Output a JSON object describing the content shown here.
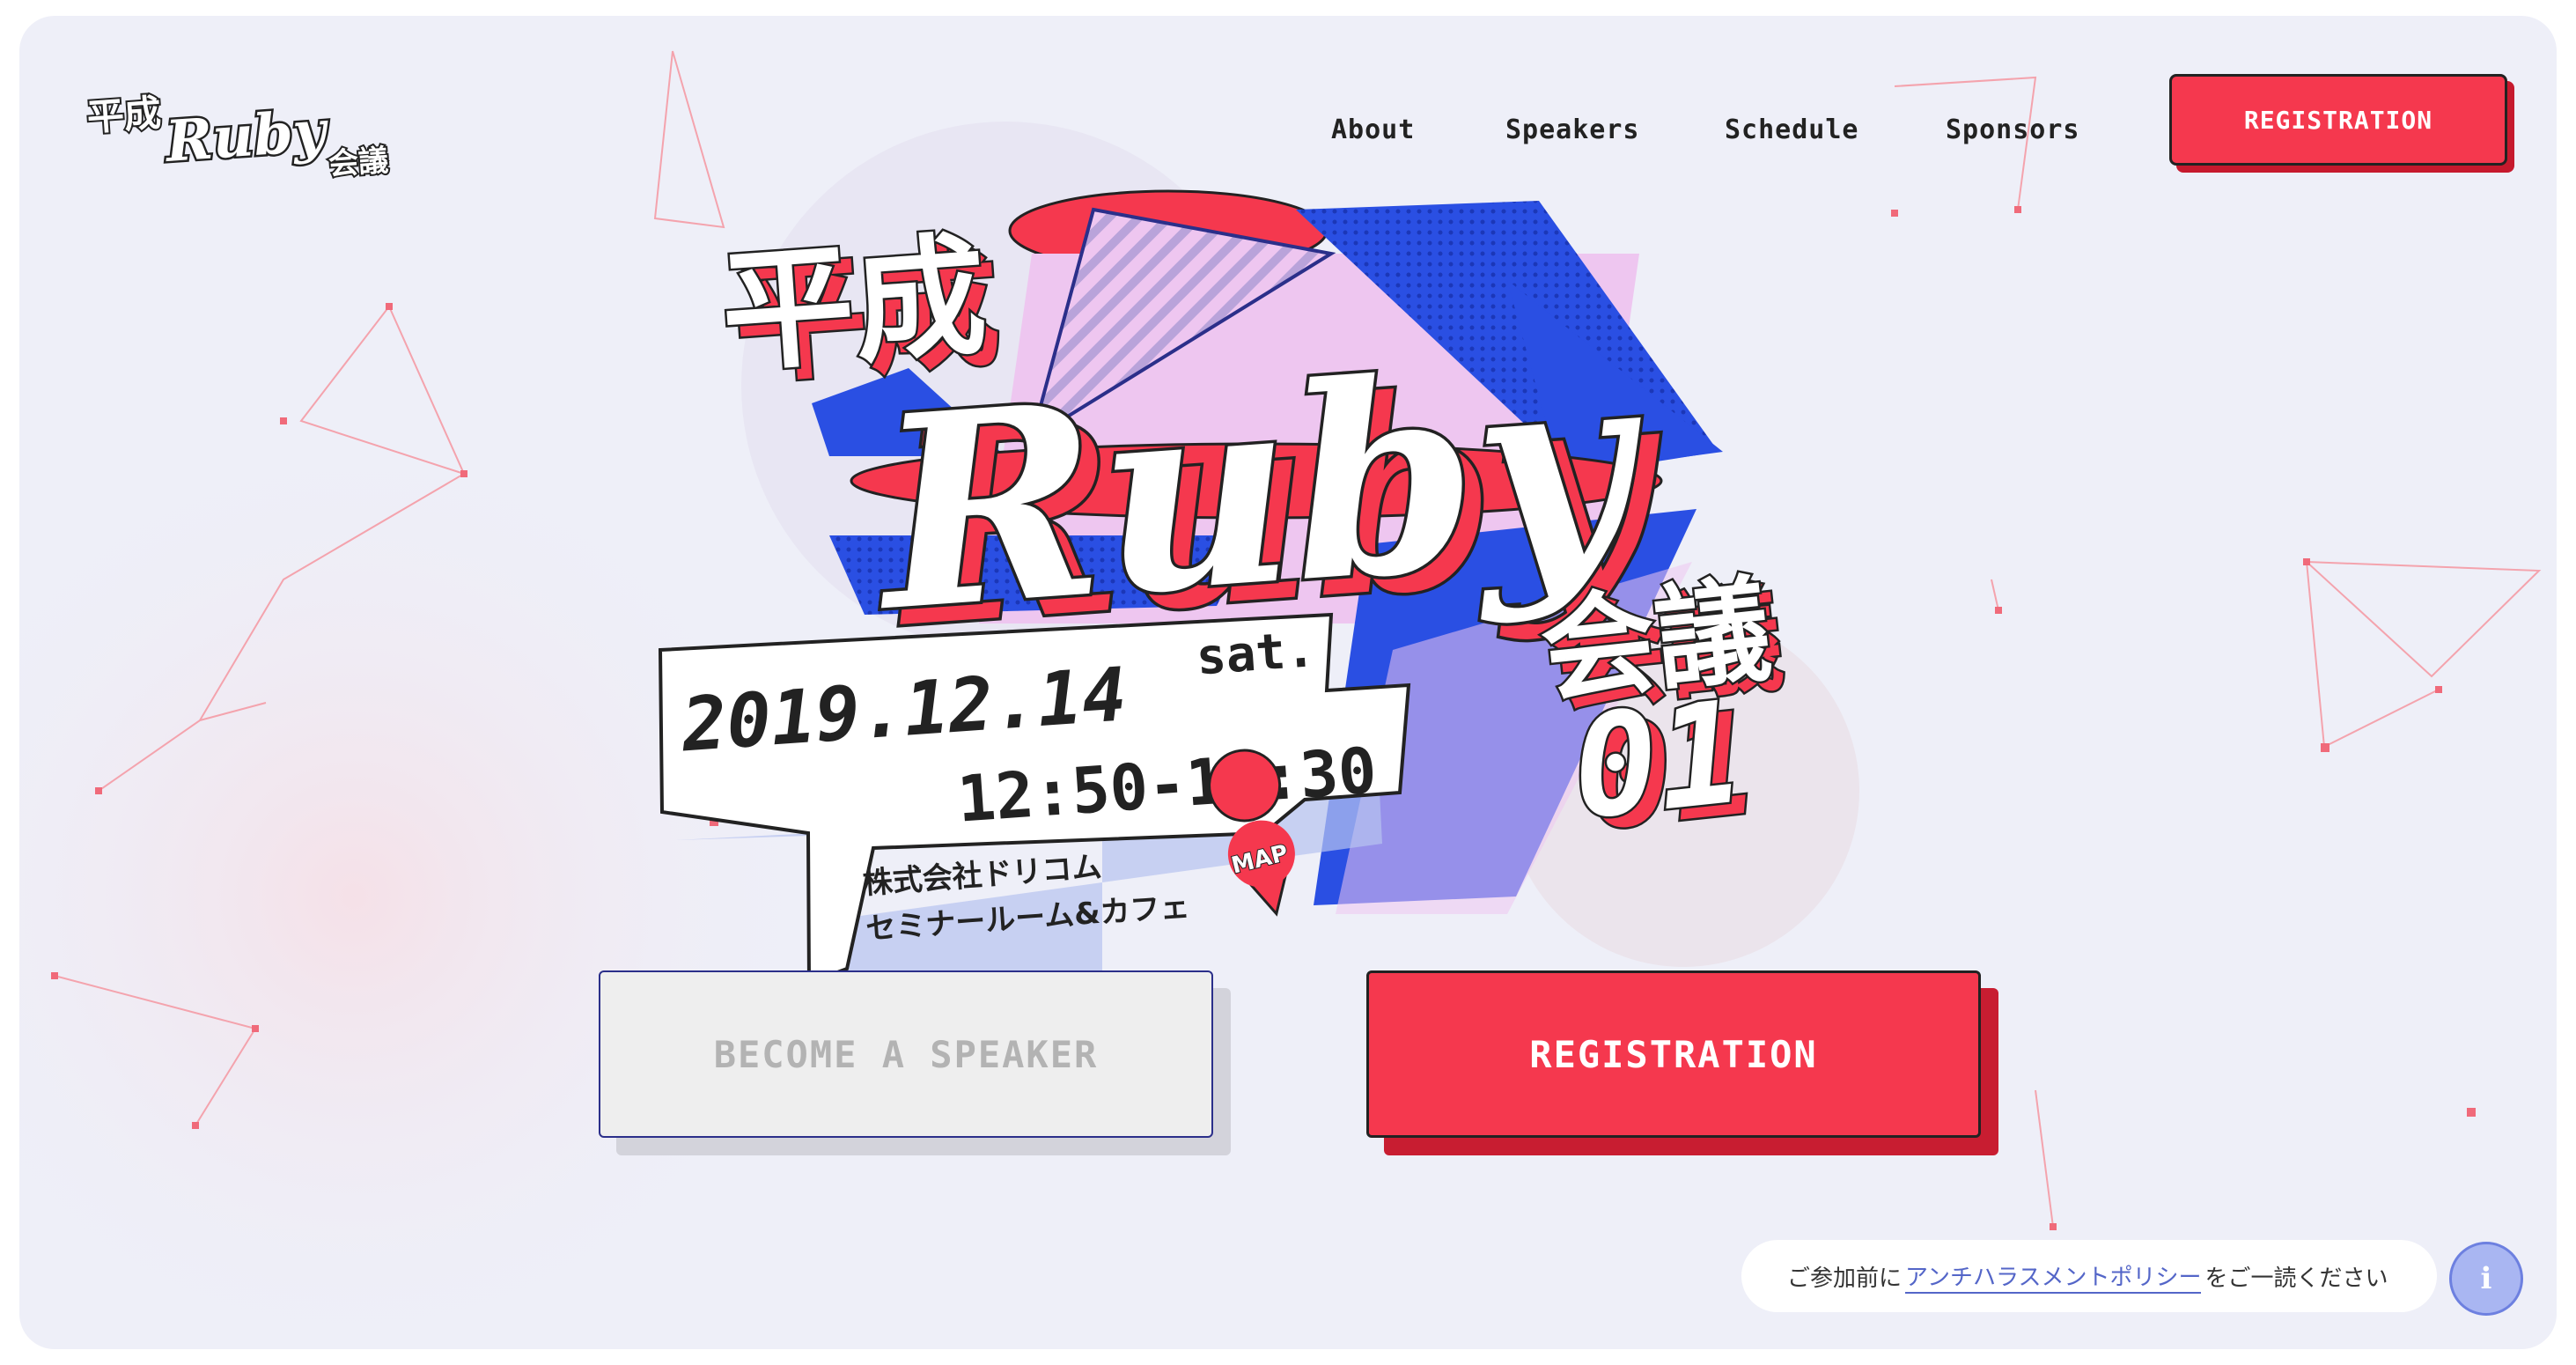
{
  "logo": {
    "line1": "平成",
    "line2": "Ruby",
    "line3": "会議"
  },
  "nav": {
    "items": [
      "About",
      "Speakers",
      "Schedule",
      "Sponsors"
    ],
    "cta": "REGISTRATION"
  },
  "hero": {
    "title_heisei": "平成",
    "title_ruby": "Ruby",
    "title_kaigi": "会議",
    "title_number": "01",
    "date": "2019.12.14",
    "weekday": "sat.",
    "time": "12:50-19:30",
    "venue_line1": "株式会社ドリコム",
    "venue_line2": "セミナールーム&カフェ",
    "map_label": "MAP"
  },
  "buttons": {
    "speaker": "BECOME A SPEAKER",
    "registration": "REGISTRATION"
  },
  "notice": {
    "prefix": "ご参加前に",
    "link": "アンチハラスメントポリシー",
    "suffix": "をご一読ください",
    "info_icon": "i"
  },
  "colors": {
    "accent": "#f5384e",
    "blue": "#2a4fe3",
    "pink": "#eec6f0",
    "background": "#eeeff8"
  }
}
